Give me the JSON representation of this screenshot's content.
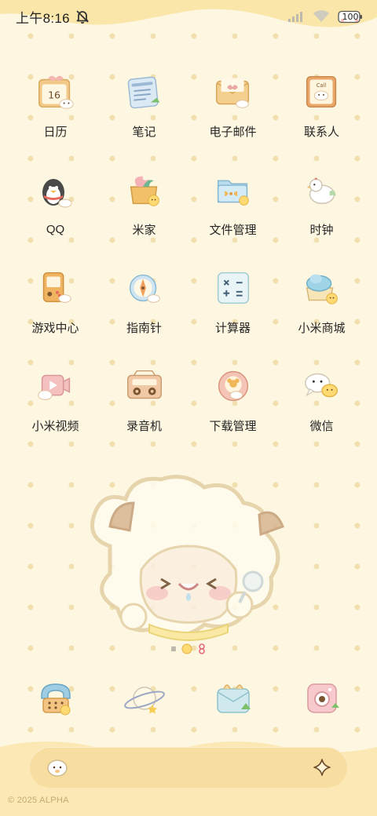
{
  "status_bar": {
    "time": "上午8:16",
    "battery": "100"
  },
  "apps": [
    {
      "label": "日历",
      "icon": "calendar-icon",
      "day": "16"
    },
    {
      "label": "笔记",
      "icon": "notes-icon"
    },
    {
      "label": "电子邮件",
      "icon": "email-icon"
    },
    {
      "label": "联系人",
      "icon": "contacts-icon",
      "book_text": "Call"
    },
    {
      "label": "QQ",
      "icon": "qq-penguin-icon"
    },
    {
      "label": "米家",
      "icon": "mijia-icon"
    },
    {
      "label": "文件管理",
      "icon": "file-manager-icon"
    },
    {
      "label": "时钟",
      "icon": "clock-bird-icon"
    },
    {
      "label": "游戏中心",
      "icon": "game-center-icon"
    },
    {
      "label": "指南针",
      "icon": "compass-icon"
    },
    {
      "label": "计算器",
      "icon": "calculator-icon"
    },
    {
      "label": "小米商城",
      "icon": "mi-store-icon"
    },
    {
      "label": "小米视频",
      "icon": "mi-video-icon"
    },
    {
      "label": "录音机",
      "icon": "recorder-icon"
    },
    {
      "label": "下载管理",
      "icon": "download-manager-icon"
    },
    {
      "label": "微信",
      "icon": "wechat-icon"
    }
  ],
  "widget": {
    "icon": "sheep-mascot-widget"
  },
  "page_indicator": {
    "menu": "≡"
  },
  "dock": [
    {
      "icon": "phone-icon"
    },
    {
      "icon": "browser-planet-icon"
    },
    {
      "icon": "messages-icon"
    },
    {
      "icon": "camera-icon"
    }
  ],
  "search_bar": {
    "left_icon": "mascot-icon",
    "right_icon": "sparkle-icon"
  },
  "watermark": "© 2025 ALPHA",
  "colors": {
    "background": "#fdf6e0",
    "dots": "#f1dfae",
    "accent": "#f5d48a",
    "icon_fill": "#fff3cf",
    "icon_outline": "#d9b167"
  }
}
